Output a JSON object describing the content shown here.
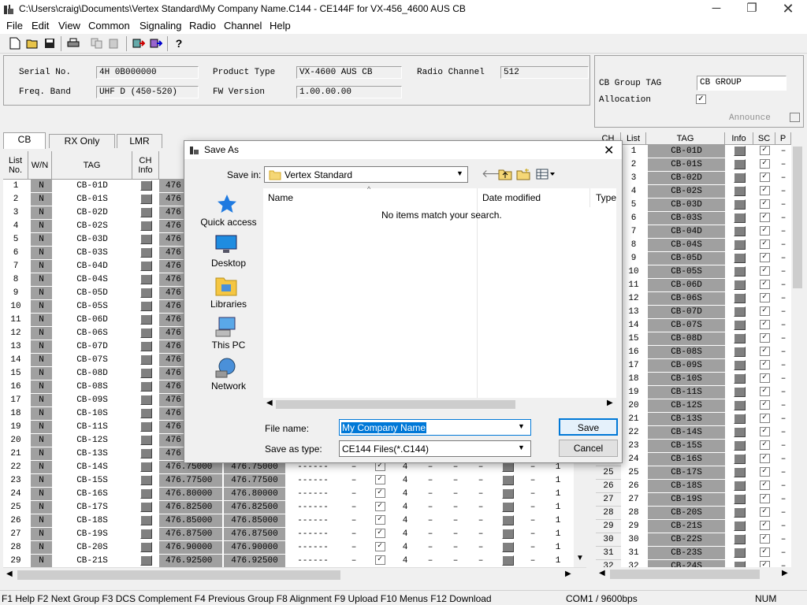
{
  "window": {
    "title": "C:\\Users\\craig\\Documents\\Vertex Standard\\My Company Name.C144 - CE144F for VX-456_4600 AUS CB"
  },
  "menu": [
    "File",
    "Edit",
    "View",
    "Common",
    "Signaling",
    "Radio",
    "Channel",
    "Help"
  ],
  "info": {
    "serial_label": "Serial No.",
    "serial": "4H 0B000000",
    "freq_label": "Freq. Band",
    "freq": "UHF D (450-520)",
    "product_label": "Product Type",
    "product": "VX-4600 AUS CB",
    "fw_label": "FW Version",
    "fw": "1.00.00.00",
    "channel_label": "Radio Channel",
    "channel": "512",
    "group_tag_label": "CB Group TAG",
    "group_tag": "CB GROUP",
    "allocation_label": "Allocation",
    "announce_label": "Announce"
  },
  "tabs": [
    "CB",
    "RX Only",
    "LMR"
  ],
  "left_table": {
    "headers": [
      "List No.",
      "W/N",
      "TAG",
      "CH Info"
    ],
    "rows": [
      {
        "no": "1",
        "wn": "N",
        "tag": "CB-01D"
      },
      {
        "no": "2",
        "wn": "N",
        "tag": "CB-01S"
      },
      {
        "no": "3",
        "wn": "N",
        "tag": "CB-02D"
      },
      {
        "no": "4",
        "wn": "N",
        "tag": "CB-02S"
      },
      {
        "no": "5",
        "wn": "N",
        "tag": "CB-03D"
      },
      {
        "no": "6",
        "wn": "N",
        "tag": "CB-03S"
      },
      {
        "no": "7",
        "wn": "N",
        "tag": "CB-04D"
      },
      {
        "no": "8",
        "wn": "N",
        "tag": "CB-04S"
      },
      {
        "no": "9",
        "wn": "N",
        "tag": "CB-05D"
      },
      {
        "no": "10",
        "wn": "N",
        "tag": "CB-05S"
      },
      {
        "no": "11",
        "wn": "N",
        "tag": "CB-06D"
      },
      {
        "no": "12",
        "wn": "N",
        "tag": "CB-06S"
      },
      {
        "no": "13",
        "wn": "N",
        "tag": "CB-07D"
      },
      {
        "no": "14",
        "wn": "N",
        "tag": "CB-07S"
      },
      {
        "no": "15",
        "wn": "N",
        "tag": "CB-08D"
      },
      {
        "no": "16",
        "wn": "N",
        "tag": "CB-08S"
      },
      {
        "no": "17",
        "wn": "N",
        "tag": "CB-09S"
      },
      {
        "no": "18",
        "wn": "N",
        "tag": "CB-10S"
      },
      {
        "no": "19",
        "wn": "N",
        "tag": "CB-11S"
      },
      {
        "no": "20",
        "wn": "N",
        "tag": "CB-12S"
      },
      {
        "no": "21",
        "wn": "N",
        "tag": "CB-13S"
      },
      {
        "no": "22",
        "wn": "N",
        "tag": "CB-14S",
        "rx": "476.75000",
        "tx": "476.75000"
      },
      {
        "no": "23",
        "wn": "N",
        "tag": "CB-15S",
        "rx": "476.77500",
        "tx": "476.77500"
      },
      {
        "no": "24",
        "wn": "N",
        "tag": "CB-16S",
        "rx": "476.80000",
        "tx": "476.80000"
      },
      {
        "no": "25",
        "wn": "N",
        "tag": "CB-17S",
        "rx": "476.82500",
        "tx": "476.82500"
      },
      {
        "no": "26",
        "wn": "N",
        "tag": "CB-18S",
        "rx": "476.85000",
        "tx": "476.85000"
      },
      {
        "no": "27",
        "wn": "N",
        "tag": "CB-19S",
        "rx": "476.87500",
        "tx": "476.87500"
      },
      {
        "no": "28",
        "wn": "N",
        "tag": "CB-20S",
        "rx": "476.90000",
        "tx": "476.90000"
      },
      {
        "no": "29",
        "wn": "N",
        "tag": "CB-21S",
        "rx": "476.92500",
        "tx": "476.92500"
      }
    ],
    "freq_stub": "476",
    "tone": "------",
    "dash": "–",
    "four": "4",
    "one": "1",
    "check": "✓"
  },
  "right_table": {
    "headers": [
      "CH",
      "List",
      "TAG",
      "Info",
      "SC",
      "P"
    ],
    "rows": [
      {
        "ch": "",
        "list": "1",
        "tag": "CB-01D"
      },
      {
        "ch": "",
        "list": "2",
        "tag": "CB-01S"
      },
      {
        "ch": "",
        "list": "3",
        "tag": "CB-02D"
      },
      {
        "ch": "",
        "list": "4",
        "tag": "CB-02S"
      },
      {
        "ch": "",
        "list": "5",
        "tag": "CB-03D"
      },
      {
        "ch": "",
        "list": "6",
        "tag": "CB-03S"
      },
      {
        "ch": "",
        "list": "7",
        "tag": "CB-04D"
      },
      {
        "ch": "",
        "list": "8",
        "tag": "CB-04S"
      },
      {
        "ch": "",
        "list": "9",
        "tag": "CB-05D"
      },
      {
        "ch": "",
        "list": "10",
        "tag": "CB-05S"
      },
      {
        "ch": "",
        "list": "11",
        "tag": "CB-06D"
      },
      {
        "ch": "",
        "list": "12",
        "tag": "CB-06S"
      },
      {
        "ch": "",
        "list": "13",
        "tag": "CB-07D"
      },
      {
        "ch": "",
        "list": "14",
        "tag": "CB-07S"
      },
      {
        "ch": "",
        "list": "15",
        "tag": "CB-08D"
      },
      {
        "ch": "",
        "list": "16",
        "tag": "CB-08S"
      },
      {
        "ch": "",
        "list": "17",
        "tag": "CB-09S"
      },
      {
        "ch": "",
        "list": "18",
        "tag": "CB-10S"
      },
      {
        "ch": "",
        "list": "19",
        "tag": "CB-11S"
      },
      {
        "ch": "",
        "list": "20",
        "tag": "CB-12S"
      },
      {
        "ch": "",
        "list": "21",
        "tag": "CB-13S"
      },
      {
        "ch": "",
        "list": "22",
        "tag": "CB-14S"
      },
      {
        "ch": "",
        "list": "23",
        "tag": "CB-15S"
      },
      {
        "ch": "",
        "list": "24",
        "tag": "CB-16S"
      },
      {
        "ch": "25",
        "list": "25",
        "tag": "CB-17S"
      },
      {
        "ch": "26",
        "list": "26",
        "tag": "CB-18S"
      },
      {
        "ch": "27",
        "list": "27",
        "tag": "CB-19S"
      },
      {
        "ch": "28",
        "list": "28",
        "tag": "CB-20S"
      },
      {
        "ch": "29",
        "list": "29",
        "tag": "CB-21S"
      },
      {
        "ch": "30",
        "list": "30",
        "tag": "CB-22S"
      },
      {
        "ch": "31",
        "list": "31",
        "tag": "CB-23S"
      },
      {
        "ch": "32",
        "list": "32",
        "tag": "CB-24S"
      }
    ]
  },
  "dialog": {
    "title": "Save As",
    "save_in_label": "Save in:",
    "save_in_value": "Vertex Standard",
    "places": [
      "Quick access",
      "Desktop",
      "Libraries",
      "This PC",
      "Network"
    ],
    "col_name": "Name",
    "col_date": "Date modified",
    "col_type": "Type",
    "empty_message": "No items match your search.",
    "file_name_label": "File name:",
    "file_name_value": "My Company Name",
    "save_type_label": "Save as type:",
    "save_type_value": "CE144 Files(*.C144)",
    "save_button": "Save",
    "cancel_button": "Cancel"
  },
  "status": {
    "keys": "F1 Help  F2 Next Group  F3 DCS Complement   F4 Previous Group  F8 Alignment  F9 Upload   F10 Menus  F12 Download",
    "port": "COM1 / 9600bps",
    "num": "NUM"
  }
}
